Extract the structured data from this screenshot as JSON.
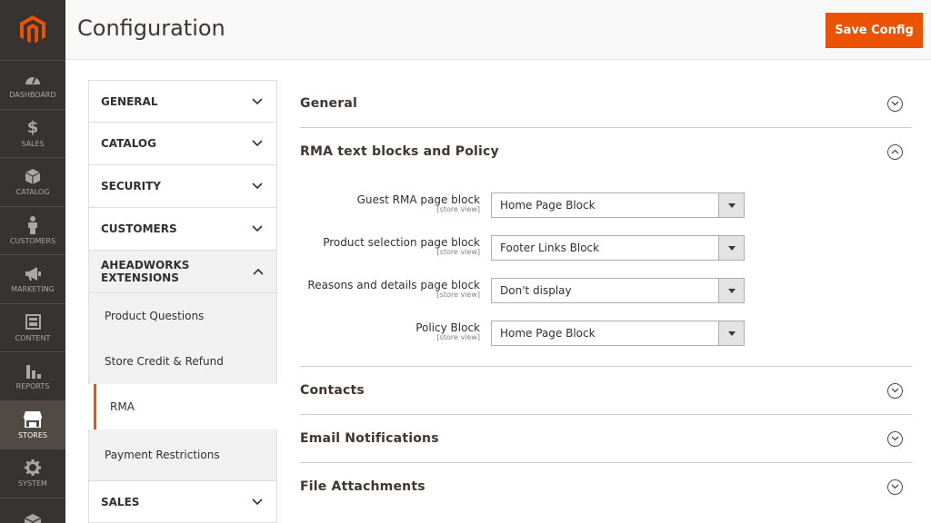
{
  "adminnav": {
    "items": [
      {
        "label": "DASHBOARD",
        "icon": "dashboard-icon"
      },
      {
        "label": "SALES",
        "icon": "dollar-icon"
      },
      {
        "label": "CATALOG",
        "icon": "box-icon"
      },
      {
        "label": "CUSTOMERS",
        "icon": "person-icon"
      },
      {
        "label": "MARKETING",
        "icon": "megaphone-icon"
      },
      {
        "label": "CONTENT",
        "icon": "layout-icon"
      },
      {
        "label": "REPORTS",
        "icon": "bar-chart-icon"
      },
      {
        "label": "STORES",
        "icon": "storefront-icon"
      },
      {
        "label": "SYSTEM",
        "icon": "gear-icon"
      },
      {
        "label": "",
        "icon": "extension-cube-icon"
      }
    ],
    "active_label": "STORES",
    "accent": "#eb5202"
  },
  "header": {
    "title": "Configuration",
    "save_label": "Save Config"
  },
  "tabs": {
    "items": [
      "GENERAL",
      "CATALOG",
      "SECURITY",
      "CUSTOMERS",
      "AHEADWORKS EXTENSIONS",
      "SALES"
    ],
    "subitems": [
      "Product Questions",
      "Store Credit & Refund",
      "RMA",
      "Payment Restrictions"
    ],
    "current_subitem": "RMA"
  },
  "main": {
    "sections": {
      "general": "General",
      "rma": "RMA text blocks and Policy",
      "contacts": "Contacts",
      "email": "Email Notifications",
      "files": "File Attachments"
    },
    "fields": [
      {
        "label": "Guest RMA page block",
        "scope": "[store view]",
        "value": "Home Page Block"
      },
      {
        "label": "Product selection page block",
        "scope": "[store view]",
        "value": "Footer Links Block"
      },
      {
        "label": "Reasons and details page block",
        "scope": "[store view]",
        "value": "Don't display"
      },
      {
        "label": "Policy Block",
        "scope": "[store view]",
        "value": "Home Page Block"
      }
    ]
  }
}
